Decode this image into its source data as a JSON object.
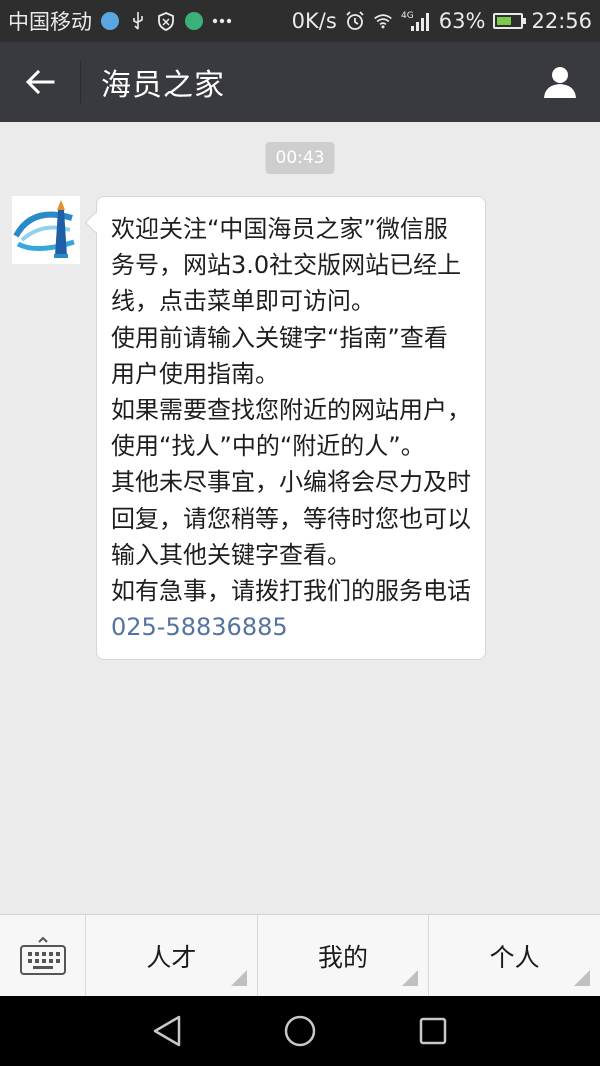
{
  "status_bar": {
    "carrier": "中国移动",
    "speed": "0K/s",
    "network": "4G",
    "battery": "63%",
    "battery_level": 0.63,
    "time": "22:56"
  },
  "header": {
    "title": "海员之家",
    "back_icon": "back-arrow-icon",
    "profile_icon": "person-icon"
  },
  "chat": {
    "timestamp": "00:43",
    "message": {
      "lines": [
        "欢迎关注“中国海员之家”微信服务号，网站3.0社交版网站已经上线，点击菜单即可访问。",
        "使用前请输入关键字“指南”查看用户使用指南。",
        "如果需要查找您附近的网站用户，使用“找人”中的“附近的人”。",
        "其他未尽事宜，小编将会尽力及时回复，请您稍等，等待时您也可以输入其他关键字查看。"
      ],
      "last_prefix": "如有急事，请拨打我们的服务电话",
      "phone": "025-58836885"
    }
  },
  "menu": {
    "keyboard_icon": "keyboard-icon",
    "items": [
      {
        "label": "人才"
      },
      {
        "label": "我的"
      },
      {
        "label": "个人"
      }
    ]
  },
  "colors": {
    "header_bg": "#393a3f",
    "status_bg": "#2e2e2e",
    "chat_bg": "#ebebeb",
    "link": "#56739f"
  }
}
